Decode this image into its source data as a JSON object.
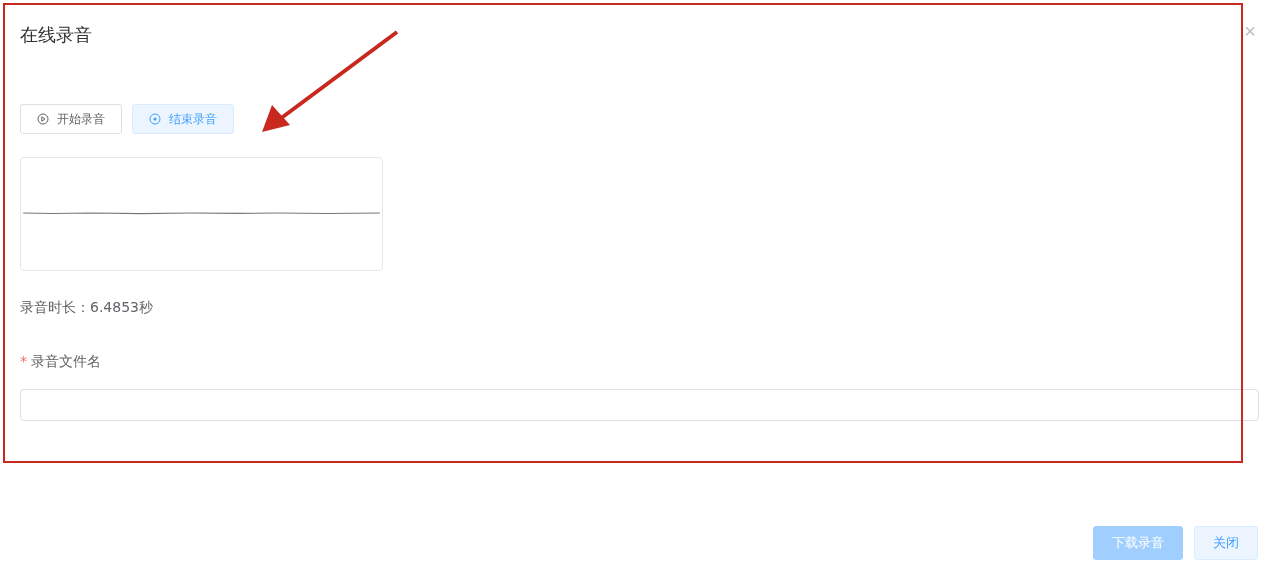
{
  "dialog": {
    "title": "在线录音",
    "close": "×"
  },
  "record_buttons": [
    {
      "label": "开始录音",
      "kind": "default"
    },
    {
      "label": "结束录音",
      "kind": "plain-primary"
    }
  ],
  "duration": "录音时长：6.4853秒",
  "filename_field": {
    "label": "录音文件名",
    "required_mark": "*"
  },
  "footer_buttons": [
    {
      "label": "下载录音",
      "kind": "primary",
      "disabled": true
    },
    {
      "label": "关闭",
      "kind": "plain-primary",
      "disabled": false
    }
  ]
}
